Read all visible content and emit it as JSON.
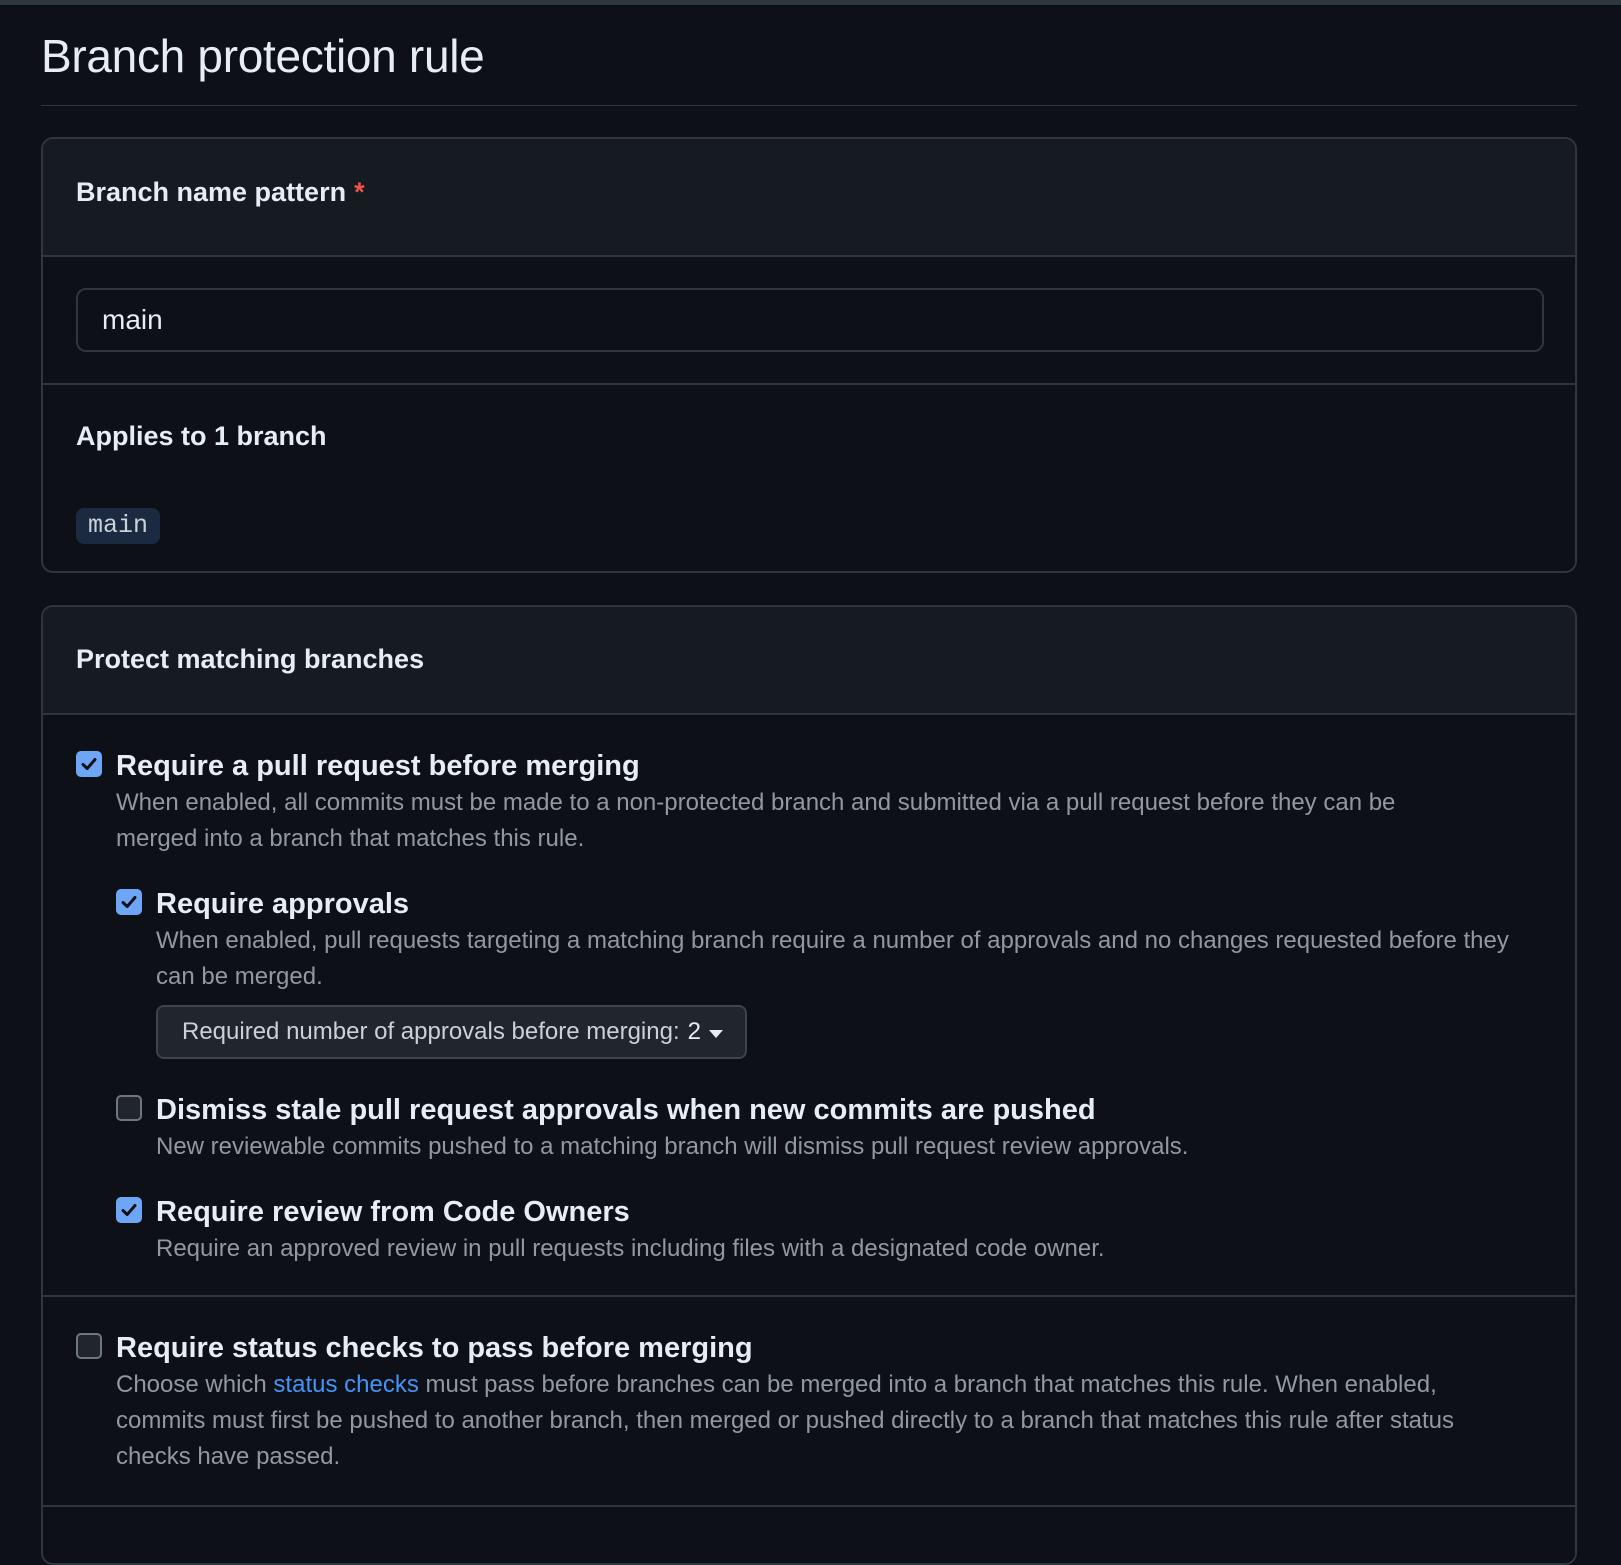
{
  "page": {
    "title": "Branch protection rule"
  },
  "pattern_box": {
    "header": "Branch name pattern",
    "required_mark": "*",
    "input_value": "main",
    "applies_title": "Applies to 1 branch",
    "branches": [
      "main"
    ]
  },
  "protect_box": {
    "header": "Protect matching branches",
    "require_pr": {
      "checked": true,
      "label": "Require a pull request before merging",
      "desc": "When enabled, all commits must be made to a non-protected branch and submitted via a pull request before they can be merged into a branch that matches this rule."
    },
    "require_approvals": {
      "checked": true,
      "label": "Require approvals",
      "desc": "When enabled, pull requests targeting a matching branch require a number of approvals and no changes requested before they can be merged.",
      "dropdown_label": "Required number of approvals before merging:",
      "dropdown_value": "2"
    },
    "dismiss_stale": {
      "checked": false,
      "label": "Dismiss stale pull request approvals when new commits are pushed",
      "desc": "New reviewable commits pushed to a matching branch will dismiss pull request review approvals."
    },
    "code_owners": {
      "checked": true,
      "label": "Require review from Code Owners",
      "desc": "Require an approved review in pull requests including files with a designated code owner."
    },
    "status_checks": {
      "checked": false,
      "label": "Require status checks to pass before merging",
      "desc_before": "Choose which ",
      "desc_link": "status checks",
      "desc_after": " must pass before branches can be merged into a branch that matches this rule. When enabled, commits must first be pushed to another branch, then merged or pushed directly to a branch that matches this rule after status checks have passed."
    }
  },
  "icons": {
    "checkbox_checked": "check-icon",
    "dropdown": "triangle-down-icon"
  },
  "colors": {
    "background": "#0d1117",
    "panel_header": "#161b22",
    "border": "#30363d",
    "checkbox_on": "#6ea6f7",
    "link": "#4493f8",
    "required": "#f85149",
    "muted_text": "#9198a1"
  }
}
